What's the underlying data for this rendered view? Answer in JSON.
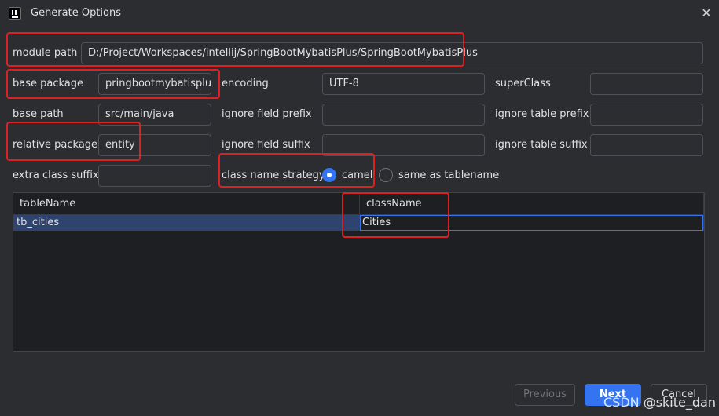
{
  "window": {
    "title": "Generate Options",
    "app_icon": "intellij-icon",
    "close_icon": "close-icon"
  },
  "form": {
    "module_path": {
      "label": "module path",
      "value": "D:/Project/Workspaces/intellij/SpringBootMybatisPlus/SpringBootMybatisPlus"
    },
    "base_package": {
      "label": "base package",
      "value": "pringbootmybatisplus"
    },
    "encoding": {
      "label": "encoding",
      "value": "UTF-8"
    },
    "super_class": {
      "label": "superClass",
      "value": ""
    },
    "base_path": {
      "label": "base path",
      "value": "src/main/java"
    },
    "ignore_field_prefix": {
      "label": "ignore field prefix",
      "value": ""
    },
    "ignore_table_prefix": {
      "label": "ignore table prefix",
      "value": ""
    },
    "relative_package": {
      "label": "relative package",
      "value": "entity"
    },
    "ignore_field_suffix": {
      "label": "ignore field suffix",
      "value": ""
    },
    "ignore_table_suffix": {
      "label": "ignore table suffix",
      "value": ""
    },
    "extra_class_suffix": {
      "label": "extra class suffix",
      "value": ""
    },
    "class_name_strategy": {
      "label": "class name strategy",
      "options": [
        "camel",
        "same as tablename"
      ],
      "selected": "camel"
    }
  },
  "table": {
    "columns": [
      "tableName",
      "className"
    ],
    "rows": [
      {
        "tableName": "tb_cities",
        "className": "Cities"
      }
    ]
  },
  "buttons": {
    "previous": "Previous",
    "next": "Next",
    "cancel": "Cancel"
  },
  "watermark": "CSDN @skite_dan",
  "colors": {
    "background": "#2b2d30",
    "accent": "#3574f0",
    "highlight_box": "#e02020",
    "selected_row": "#2e436e"
  }
}
